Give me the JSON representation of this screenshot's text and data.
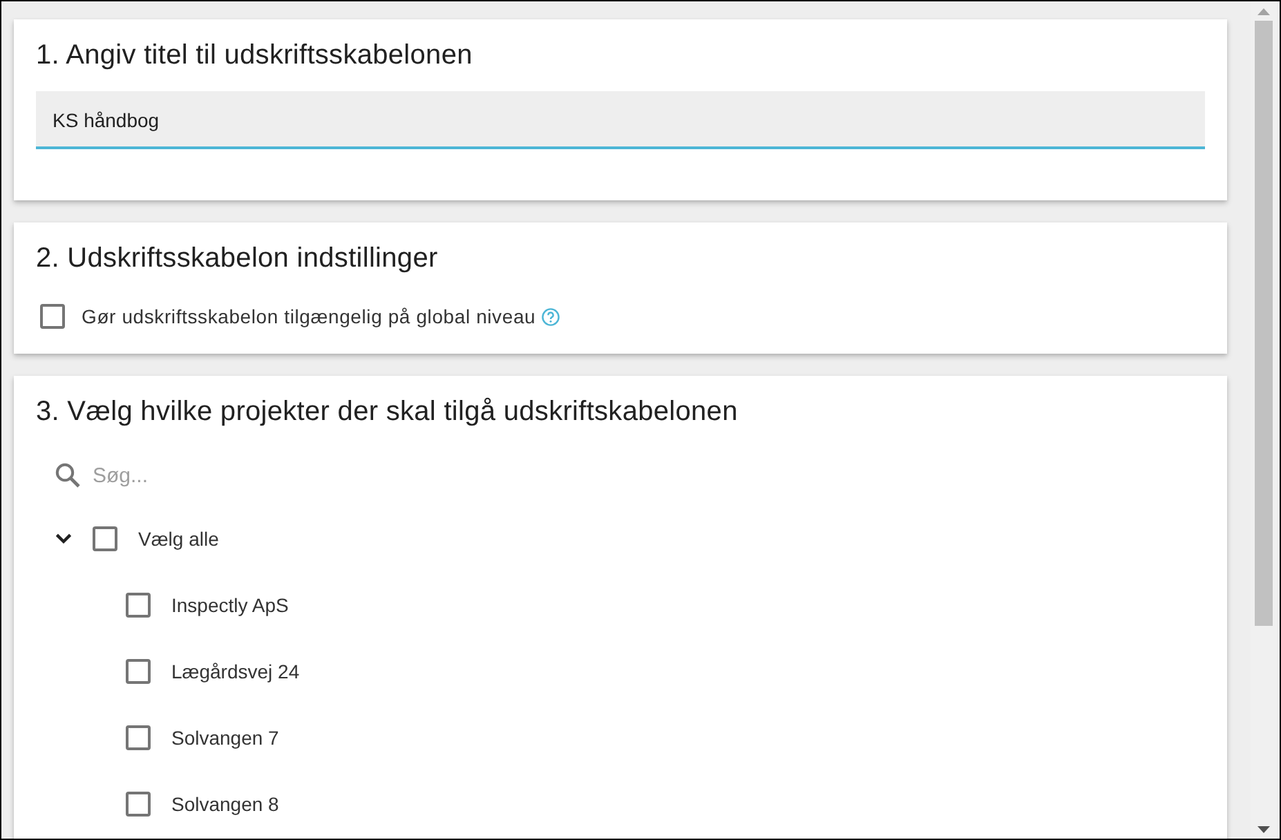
{
  "sections": [
    {
      "kind": "text_field",
      "title": "1. Angiv titel til udskriftsskabelonen",
      "field": {
        "value": "KS håndbog",
        "focused": true
      }
    },
    {
      "kind": "checkbox",
      "title": "2. Udskriftsskabelon indstillinger",
      "option": {
        "label": "Gør udskriftsskabelon tilgængelig på global niveau",
        "checked": false,
        "help": true
      }
    },
    {
      "kind": "tree",
      "title": "3. Vælg hvilke projekter der skal tilgå udskriftskabelonen",
      "search": {
        "placeholder": "Søg..."
      },
      "tree": [
        {
          "label": "Vælg alle",
          "checked": false,
          "expanded": true,
          "children": [
            {
              "label": "Inspectly ApS",
              "checked": false
            },
            {
              "label": "Lægårdsvej 24",
              "checked": false
            },
            {
              "label": "Solvangen 7",
              "checked": false
            },
            {
              "label": "Solvangen 8",
              "checked": false
            }
          ]
        }
      ]
    }
  ]
}
